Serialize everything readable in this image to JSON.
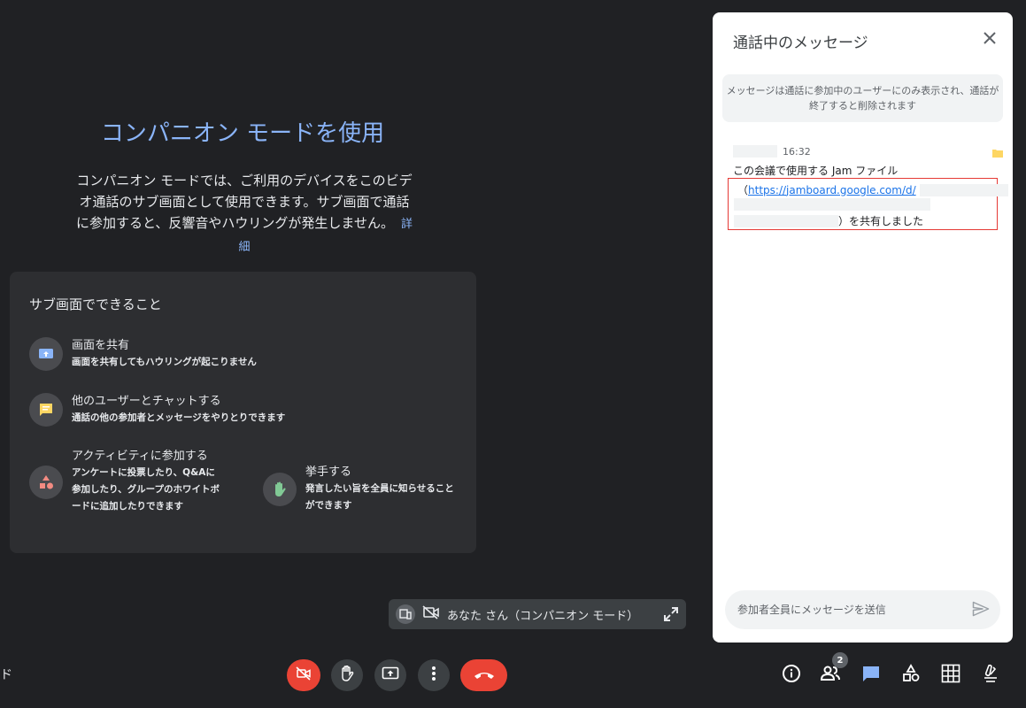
{
  "intro": {
    "title": "コンパニオン モードを使用",
    "description": "コンパニオン モードでは、ご利用のデバイスをこのビデオ通話のサブ画面として使用できます。サブ画面で通話に参加すると、反響音やハウリングが発生しません。",
    "details_link": "詳細"
  },
  "features": {
    "title": "サブ画面でできること",
    "items": [
      {
        "name": "画面を共有",
        "desc": "画面を共有してもハウリングが起こりません",
        "icon": "present-screen-icon"
      },
      {
        "name": "他のユーザーとチャットする",
        "desc": "通話の他の参加者とメッセージをやりとりできます",
        "icon": "chat-icon"
      },
      {
        "name": "アクティビティに参加する",
        "desc": "アンケートに投票したり、Q&Aに参加したり、グループのホワイトボードに追加したりできます",
        "icon": "activities-icon"
      },
      {
        "name": "挙手する",
        "desc": "発言したい旨を全員に知らせることができます",
        "icon": "raise-hand-icon"
      }
    ]
  },
  "self_tile": {
    "label": "あなた さん（コンパニオン モード）"
  },
  "bottom_bar": {
    "left_text": "ド",
    "people_count": "2"
  },
  "chat_panel": {
    "title": "通話中のメッセージ",
    "notice": "メッセージは通話に参加中のユーザーにのみ表示され、通話が終了すると削除されます",
    "message": {
      "time": "16:32",
      "line1": "この会議で使用する Jam ファイル",
      "open_paren": "（",
      "link": "https://jamboard.google.com/d/",
      "suffix": "）を共有しました"
    },
    "input_placeholder": "参加者全員にメッセージを送信"
  },
  "colors": {
    "background": "#202124",
    "accent_blue": "#8ab4f8",
    "end_call_red": "#ea4335",
    "panel_bg": "#ffffff"
  }
}
